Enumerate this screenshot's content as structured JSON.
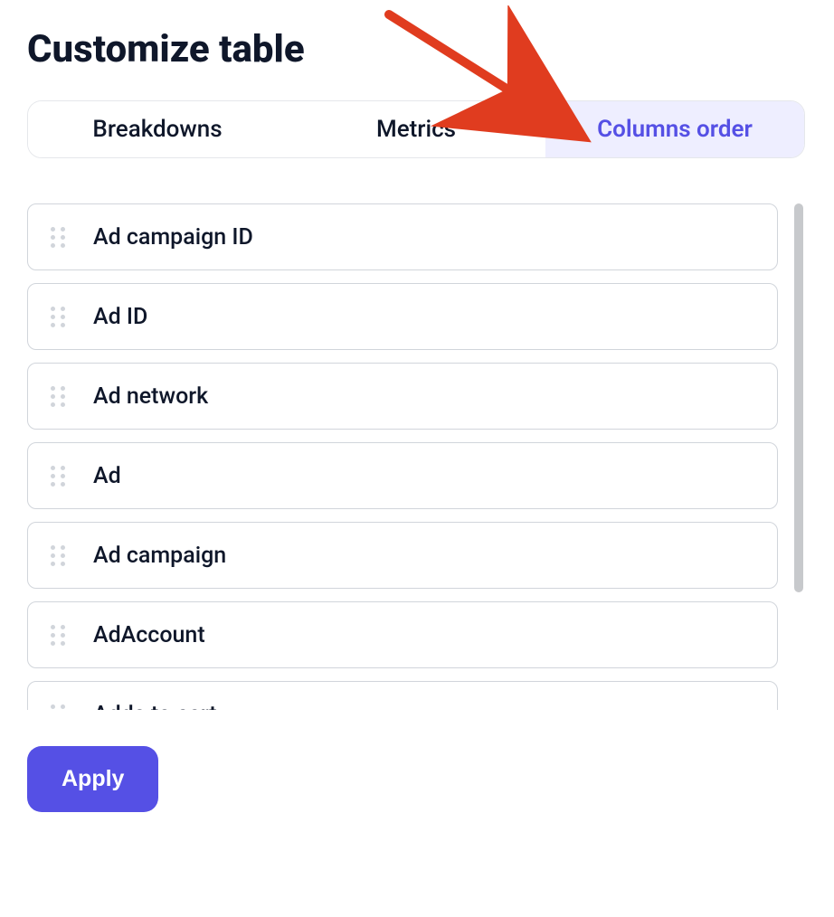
{
  "title": "Customize table",
  "tabs": [
    {
      "label": "Breakdowns",
      "active": false
    },
    {
      "label": "Metrics",
      "active": false
    },
    {
      "label": "Columns order",
      "active": true
    }
  ],
  "columns": [
    {
      "label": "Ad campaign ID"
    },
    {
      "label": "Ad ID"
    },
    {
      "label": "Ad network"
    },
    {
      "label": "Ad"
    },
    {
      "label": "Ad campaign"
    },
    {
      "label": "AdAccount"
    },
    {
      "label": "Adds to cart"
    }
  ],
  "apply_label": "Apply",
  "colors": {
    "accent": "#5550e5",
    "arrow": "#e03c1f"
  }
}
